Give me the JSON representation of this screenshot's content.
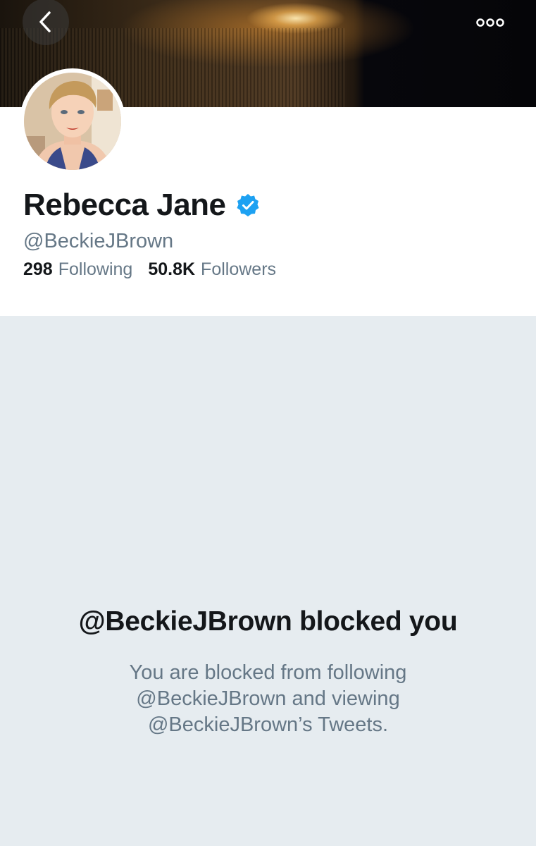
{
  "profile": {
    "name": "Rebecca Jane",
    "handle": "@BeckieJBrown",
    "verified": true,
    "following_count": "298",
    "following_label": "Following",
    "followers_count": "50.8K",
    "followers_label": "Followers"
  },
  "header": {
    "back_icon": "chevron-left-icon",
    "more_icon": "more-options-icon"
  },
  "blocked": {
    "title": "@BeckieJBrown blocked you",
    "description": "You are blocked from following @BeckieJBrown and viewing @BeckieJBrown’s Tweets."
  },
  "colors": {
    "text_primary": "#14171a",
    "text_secondary": "#657786",
    "verified_blue": "#1da1f2",
    "blocked_background": "#e6ecf0"
  }
}
